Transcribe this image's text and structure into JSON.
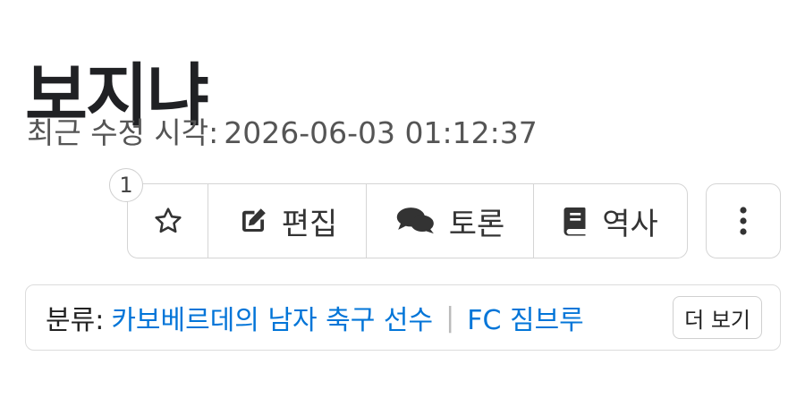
{
  "page": {
    "title": "보지냐",
    "last_modified_label": "최근 수정 시각:",
    "last_modified_time": "2026-06-03 01:12:37"
  },
  "actions": {
    "star_count": "1",
    "edit_label": "편집",
    "discuss_label": "토론",
    "history_label": "역사"
  },
  "category": {
    "label": "분류:",
    "items": [
      "카보베르데의 남자 축구 선수",
      "FC 짐브루"
    ],
    "separator": "|",
    "more_label": "더 보기"
  },
  "icons": {
    "star": "star-outline-icon",
    "edit": "pencil-square-icon",
    "discuss": "chat-bubbles-icon",
    "history": "book-icon",
    "more": "vertical-ellipsis-icon"
  },
  "colors": {
    "link": "#0275d8",
    "border": "#d5d5d5",
    "text_muted": "#555555"
  }
}
